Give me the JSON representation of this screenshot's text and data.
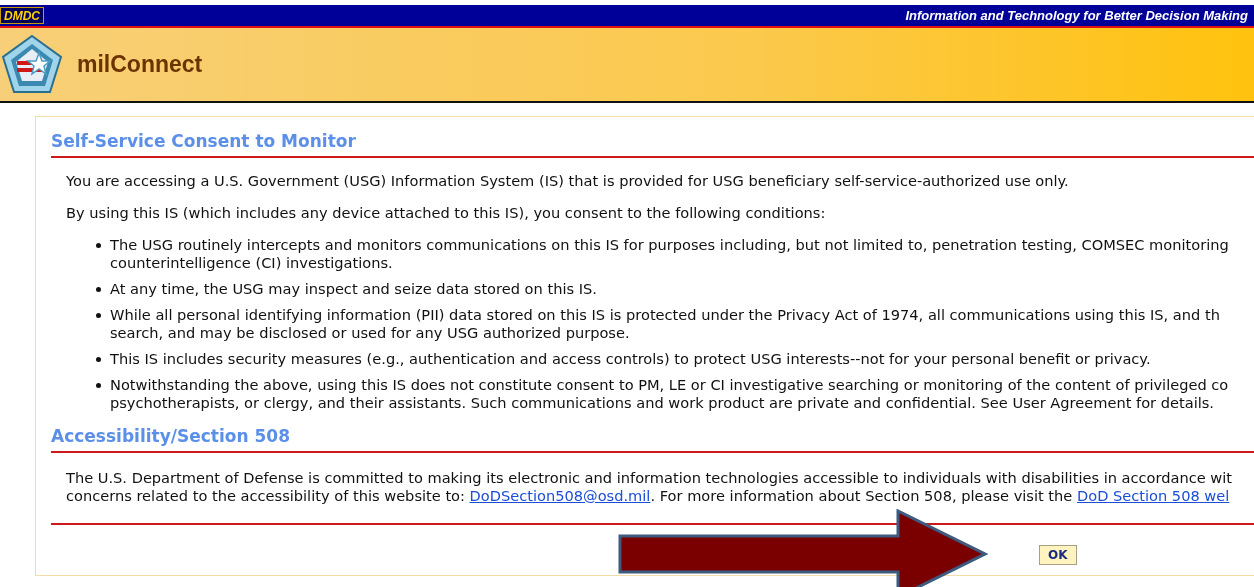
{
  "top_bar": {
    "org": "DMDC",
    "tagline": "Information and Technology for Better Decision Making"
  },
  "header": {
    "app_name": "milConnect"
  },
  "sections": [
    {
      "title": "Self-Service Consent to Monitor",
      "paragraphs": [
        "You are accessing a U.S. Government (USG) Information System (IS) that is provided for USG beneficiary self-service-authorized use only.",
        "By using this IS (which includes any device attached to this IS), you consent to the following conditions:"
      ],
      "bullets": [
        "The USG routinely intercepts and monitors communications on this IS for purposes including, but not limited to, penetration testing, COMSEC monitoring\ncounterintelligence (CI) investigations.",
        "At any time, the USG may inspect and seize data stored on this IS.",
        "While all personal identifying information (PII) data stored on this IS is protected under the Privacy Act of 1974, all communications using this IS, and th\nsearch, and may be disclosed or used for any USG authorized purpose.",
        "This IS includes security measures (e.g., authentication and access controls) to protect USG interests--not for your personal benefit or privacy.",
        "Notwithstanding the above, using this IS does not constitute consent to PM, LE or CI investigative searching or monitoring of the content of privileged co\npsychotherapists, or clergy, and their assistants. Such communications and work product are private and confidential. See User Agreement for details."
      ]
    },
    {
      "title": "Accessibility/Section 508",
      "parts": [
        {
          "kind": "text",
          "text": "The U.S. Department of Defense is committed to making its electronic and information technologies accessible to individuals with disabilities in accordance wit\nconcerns related to the accessibility of this website to: "
        },
        {
          "kind": "link",
          "text": "DoDSection508@osd.mil"
        },
        {
          "kind": "text",
          "text": ". For more information about Section 508, please visit the "
        },
        {
          "kind": "link",
          "text": "DoD Section 508 wel"
        }
      ]
    }
  ],
  "ok_button": "OK"
}
